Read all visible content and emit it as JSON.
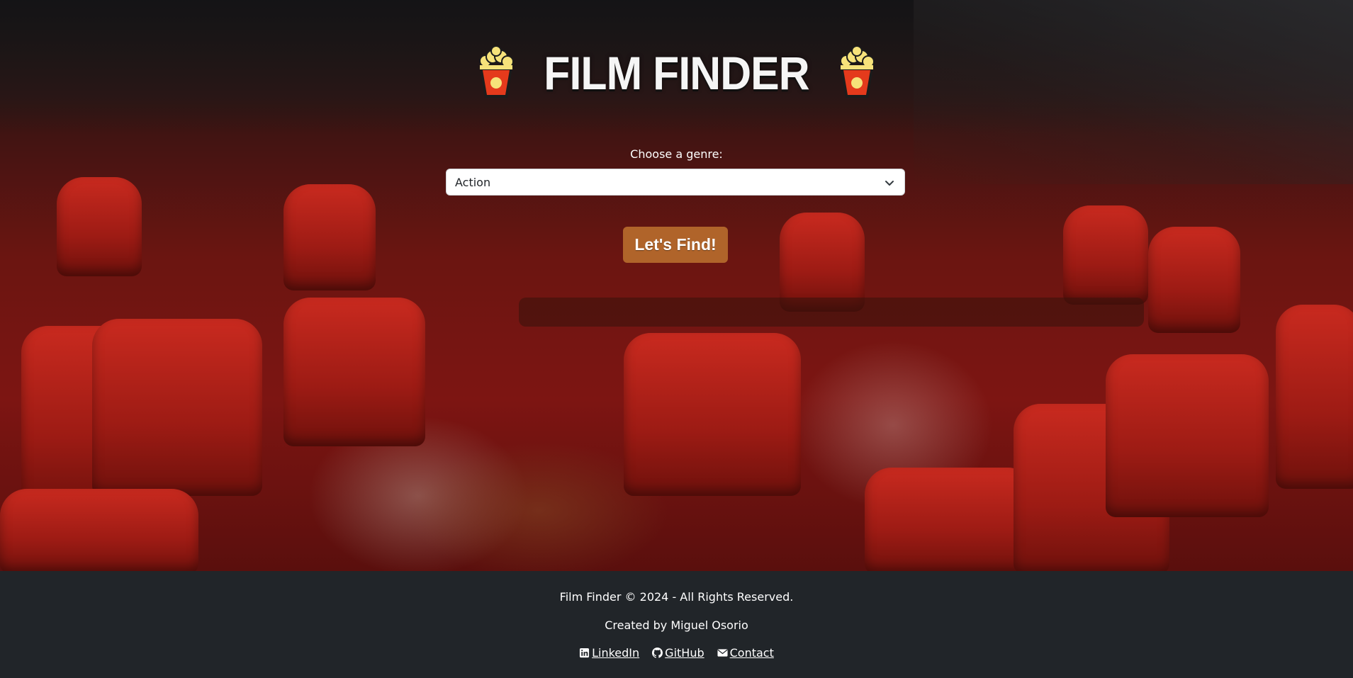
{
  "app": {
    "title": "FILM FINDER",
    "logo_icon": "popcorn-icon"
  },
  "form": {
    "genre_label": "Choose a genre:",
    "genre_selected": "Action",
    "find_button_label": "Let's Find!"
  },
  "footer": {
    "copyright": "Film Finder © 2024 - All Rights Reserved.",
    "credit": "Created by Miguel Osorio",
    "links": [
      {
        "label": "LinkedIn",
        "icon": "linkedin-icon"
      },
      {
        "label": "GitHub",
        "icon": "github-icon"
      },
      {
        "label": "Contact",
        "icon": "envelope-icon"
      }
    ]
  },
  "colors": {
    "button": "#b0642a",
    "footer_bg": "#212529",
    "popcorn_red": "#e43a1c",
    "popcorn_yellow": "#f6e27a"
  }
}
